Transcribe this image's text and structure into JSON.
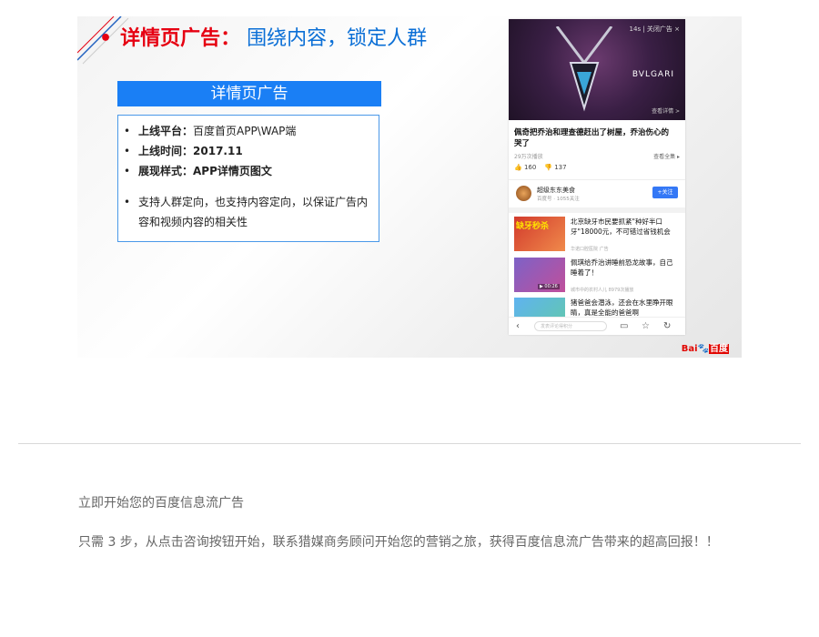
{
  "slide": {
    "title_bullet": "•",
    "title_part1": "详情页广告：",
    "title_part2": "围绕内容，锁定人群",
    "info_header": "详情页广告",
    "items": [
      {
        "label": "上线平台：",
        "value": "百度首页APP\\WAP端"
      },
      {
        "label": "上线时间：",
        "value": "2017.11"
      },
      {
        "label": "展现样式：",
        "value": "APP详情页图文"
      }
    ],
    "note": "支持人群定向，也支持内容定向，以保证广告内容和视频内容的相关性",
    "colors": {
      "title_red": "#e60012",
      "title_blue": "#0b6fd6",
      "header_blue": "#1a7ff5"
    }
  },
  "phone": {
    "ad_top": "14s | 关闭广告 ×",
    "ad_brand": "BVLGARI",
    "ad_more": "查看详情 >",
    "article_title": "佩奇把乔治和理查德赶出了树屋，乔治伤心的哭了",
    "views": "29万次播放",
    "view_all": "查看全集 ▸",
    "likes": "160",
    "dislikes": "137",
    "author_name": "超级东东美食",
    "author_sub": "百度号 · 1055关注",
    "follow": "+关注",
    "feed": [
      {
        "thumb_label": "缺牙秒杀",
        "title": "北京缺牙市民要抓紧\"种好半口牙\"18000元，不可错过省钱机会",
        "meta": "华诺口腔医院  广告"
      },
      {
        "thumb_label": "",
        "title": "佩琪给乔治讲睡前恐龙故事，自己睡着了！",
        "meta": "城市中的农村人儿 8979次播放",
        "time": "▶ 00:26"
      },
      {
        "thumb_label": "",
        "title": "猪爸爸会潜泳，还会在水里睁开眼睛，真是全能的爸爸啊",
        "meta": ""
      }
    ],
    "comment_placeholder": "发表评论得积分",
    "icons": [
      "back-icon",
      "comment-icon",
      "star-icon",
      "share-icon"
    ]
  },
  "watermark": {
    "bai": "Bai",
    "paw": "🐾",
    "du": "百度"
  },
  "cta": {
    "line1": "立即开始您的百度信息流广告",
    "line2": "只需 3 步，从点击咨询按钮开始，联系猎媒商务顾问开始您的营销之旅，获得百度信息流广告带来的超高回报！！"
  }
}
